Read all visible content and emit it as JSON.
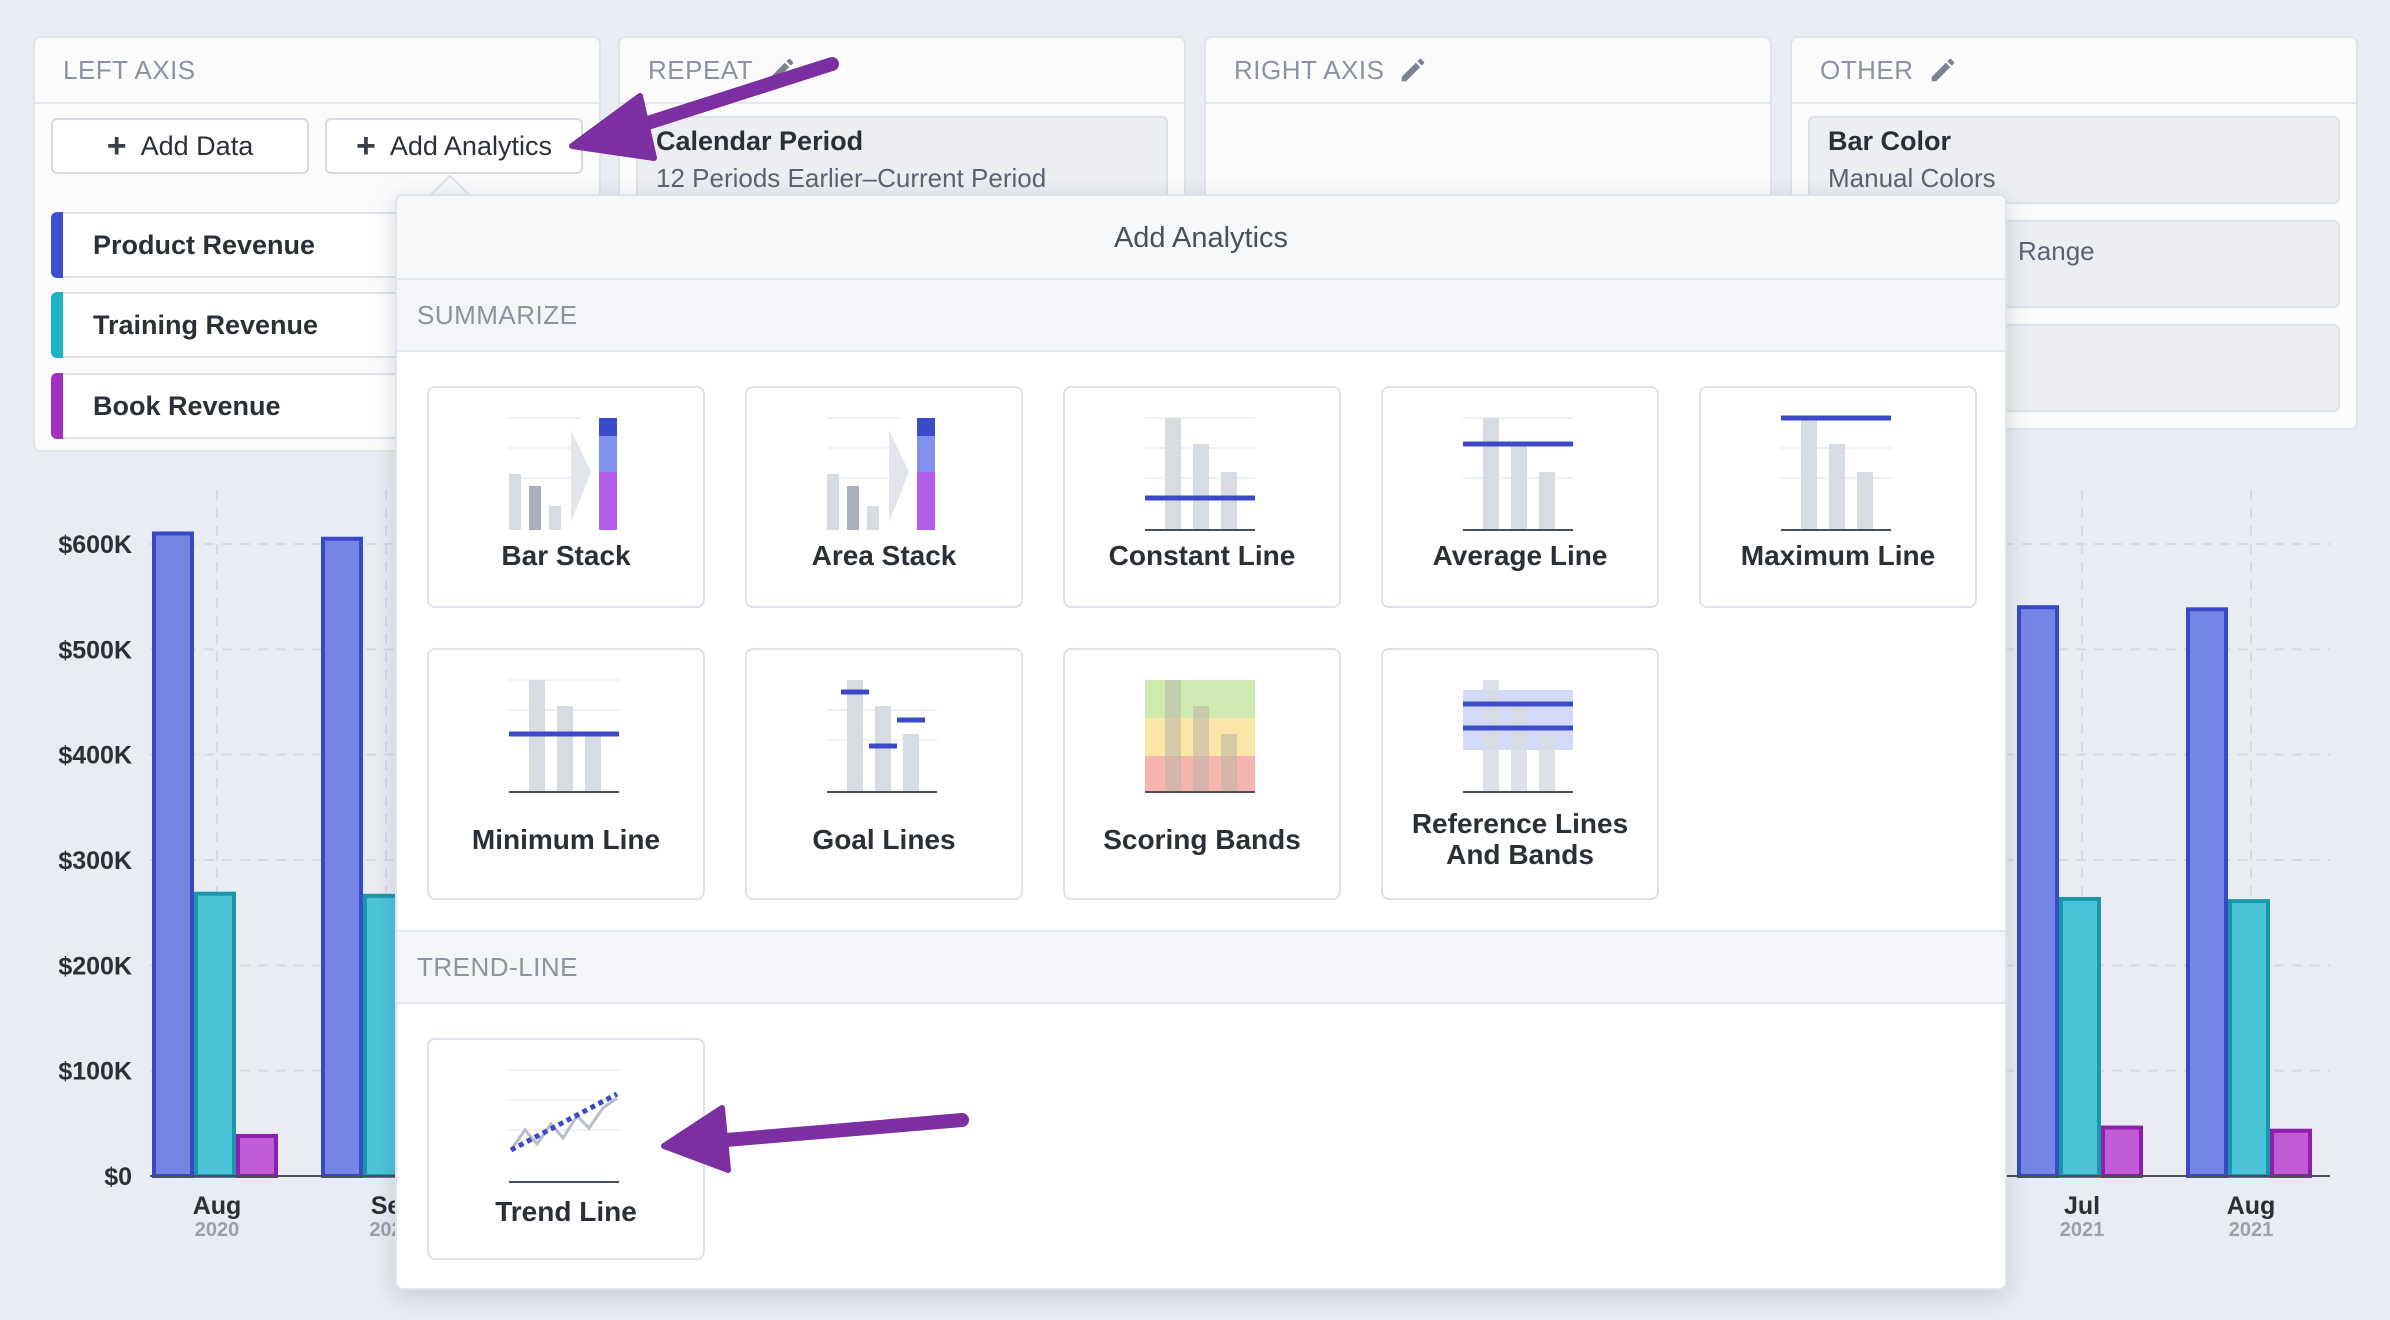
{
  "left_axis": {
    "title": "LEFT AXIS",
    "add_data_label": "Add Data",
    "add_analytics_label": "Add Analytics",
    "series": [
      {
        "label": "Product Revenue",
        "color": "#3d4fd0"
      },
      {
        "label": "Training Revenue",
        "color": "#1fb3c7"
      },
      {
        "label": "Book Revenue",
        "color": "#a42fc4"
      }
    ]
  },
  "repeat": {
    "title": "REPEAT",
    "item_title": "Calendar Period",
    "item_sub": "12 Periods Earlier–Current Period"
  },
  "right_axis": {
    "title": "RIGHT AXIS"
  },
  "other": {
    "title": "OTHER",
    "items": [
      {
        "title": "Bar Color",
        "sub": "Manual Colors"
      },
      {
        "title": "",
        "sub": "Range"
      },
      {
        "title": "",
        "sub": ""
      }
    ]
  },
  "dropdown": {
    "title": "Add Analytics",
    "sections": [
      {
        "name": "SUMMARIZE",
        "tiles": [
          "Bar Stack",
          "Area Stack",
          "Constant Line",
          "Average Line",
          "Maximum Line",
          "Minimum Line",
          "Goal Lines",
          "Scoring Bands",
          "Reference Lines And Bands"
        ]
      },
      {
        "name": "TREND-LINE",
        "tiles": [
          "Trend Line"
        ]
      }
    ]
  },
  "chart_data": {
    "type": "bar",
    "y_ticks": [
      "$600K",
      "$500K",
      "$400K",
      "$300K",
      "$200K",
      "$100K",
      "$0"
    ],
    "ylim": [
      0,
      650000
    ],
    "visible_categories": [
      {
        "month": "Aug",
        "year": "2020",
        "values": [
          610000,
          268000,
          38000
        ]
      },
      {
        "month": "Se",
        "year": "202",
        "values": [
          605000,
          266000,
          null
        ]
      },
      {
        "month": "Jul",
        "year": "2021",
        "values": [
          540000,
          263000,
          46000
        ]
      },
      {
        "month": "Aug",
        "year": "2021",
        "values": [
          538000,
          261000,
          43000
        ]
      }
    ],
    "series": [
      {
        "name": "Product Revenue",
        "color": "#7485e3",
        "stroke": "#3848c6"
      },
      {
        "name": "Training Revenue",
        "color": "#4cc4d8",
        "stroke": "#1998ac"
      },
      {
        "name": "Book Revenue",
        "color": "#c25bd6",
        "stroke": "#8e1fae"
      }
    ]
  }
}
